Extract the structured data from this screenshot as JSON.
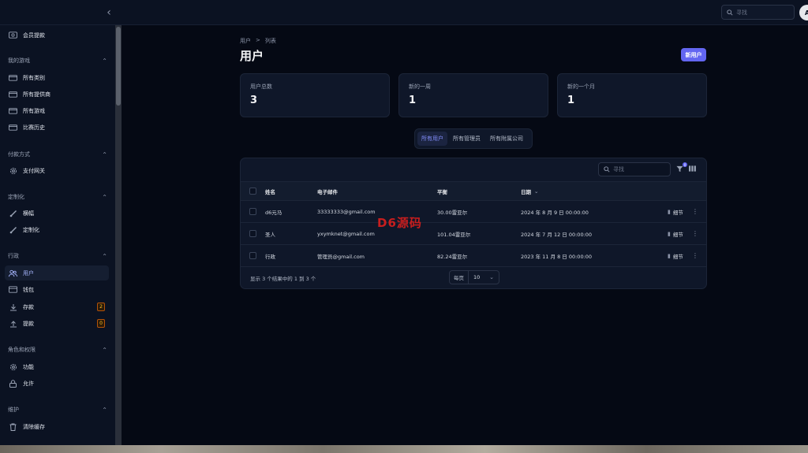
{
  "topbar": {
    "search_placeholder": "寻找",
    "avatar_letter": "A"
  },
  "sidebar": {
    "top_item": "会员提款",
    "groups": [
      {
        "label": "我的游戏",
        "items": [
          "所有类别",
          "所有提供商",
          "所有游戏",
          "比赛历史"
        ]
      },
      {
        "label": "付款方式",
        "items": [
          "支付网关"
        ]
      },
      {
        "label": "定制化",
        "items": [
          "横幅",
          "定制化"
        ]
      },
      {
        "label": "行政",
        "items": [
          "用户",
          "钱包",
          "存款",
          "提款"
        ]
      },
      {
        "label": "角色和权限",
        "items": [
          "功能",
          "允许"
        ]
      },
      {
        "label": "维护",
        "items": [
          "清除缓存"
        ]
      }
    ],
    "badges": {
      "deposit": "2",
      "withdraw": "0"
    }
  },
  "breadcrumb": {
    "first": "用户",
    "separator": ">",
    "second": "列表"
  },
  "page_title": "用户",
  "new_user_button": "新用户",
  "stats": [
    {
      "label": "用户总数",
      "value": "3"
    },
    {
      "label": "新的一周",
      "value": "1"
    },
    {
      "label": "新的一个月",
      "value": "1"
    }
  ],
  "tabs": [
    "所有用户",
    "所有管理员",
    "所有附属公司"
  ],
  "table": {
    "search_placeholder": "寻找",
    "filter_count": "0",
    "headers": {
      "name": "姓名",
      "email": "电子邮件",
      "balance": "平衡",
      "date": "日期"
    },
    "rows": [
      {
        "name": "d6元马",
        "email": "33333333@gmail.com",
        "balance": "30.00雷亚尔",
        "date": "2024 年 8 月 9 日 00:00:00",
        "detail": "细节"
      },
      {
        "name": "圣人",
        "email": "yxymknet@gmail.com",
        "balance": "101.04雷亚尔",
        "date": "2024 年 7 月 12 日 00:00:00",
        "detail": "细节"
      },
      {
        "name": "行政",
        "email": "管理员@gmail.com",
        "balance": "82.24雷亚尔",
        "date": "2023 年 11 月 8 日 00:00:00",
        "detail": "细节"
      }
    ],
    "footer_text": "显示 3 个结果中的 1 到 3 个",
    "per_page_label": "每页",
    "per_page_value": "10"
  },
  "watermark": "D6源码",
  "colors": {
    "accent": "#6366f1",
    "background": "#050914",
    "panel": "#0f1729"
  }
}
